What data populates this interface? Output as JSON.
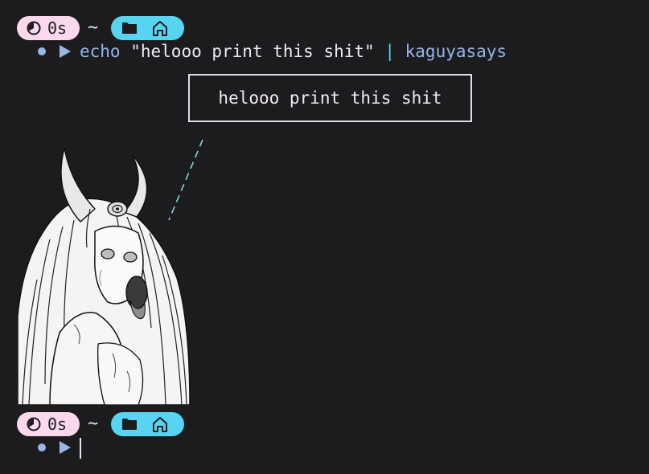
{
  "theme": {
    "background": "#1c1c1e",
    "time_pill": "#fbd8ec",
    "dir_pill": "#57d4ef",
    "command_color": "#94b6ec",
    "pipe_color": "#57d4ef",
    "text_color": "#e4e4ea"
  },
  "prompt1": {
    "duration": "0s",
    "tilde": "~",
    "icons": [
      "timer-icon",
      "folder-icon",
      "home-icon"
    ]
  },
  "command1": {
    "program": "echo",
    "argument": "\"helooo print this shit\"",
    "pipe": "|",
    "piped_program": "kaguyasays"
  },
  "output": {
    "speech_text": "helooo print this shit",
    "image": "horned-anime-girl-ascii-art"
  },
  "prompt2": {
    "duration": "0s",
    "tilde": "~",
    "icons": [
      "timer-icon",
      "folder-icon",
      "home-icon"
    ]
  },
  "command2": {
    "input": ""
  }
}
